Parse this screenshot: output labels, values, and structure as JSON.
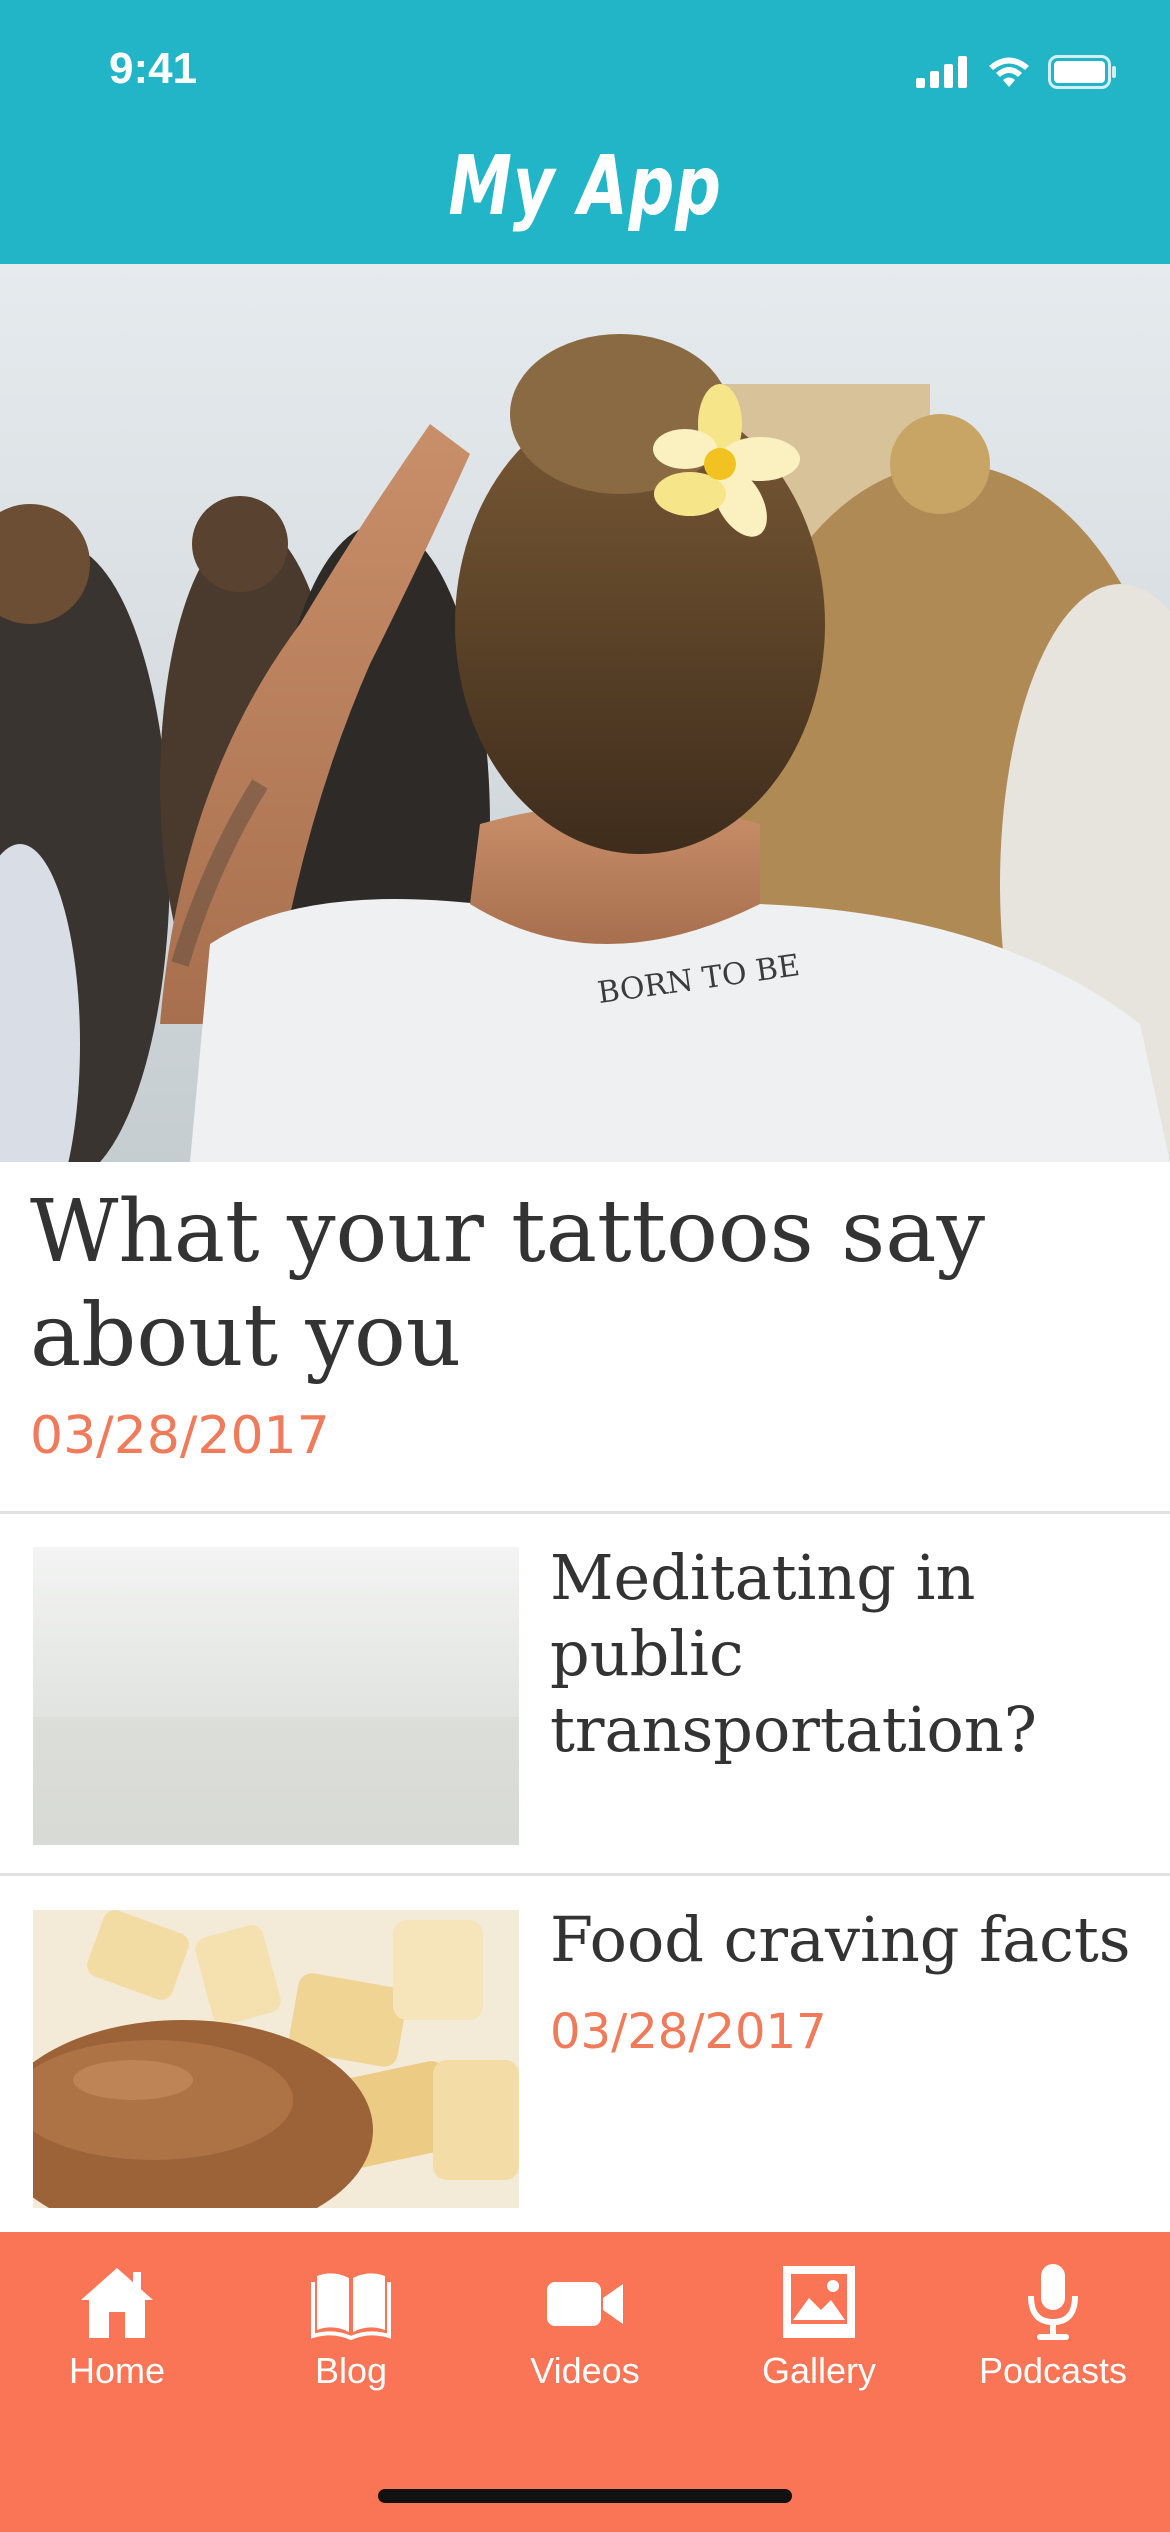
{
  "status_bar": {
    "time": "9:41"
  },
  "header": {
    "title": "My App",
    "color": "#22b5c8"
  },
  "featured": {
    "title": "What your tattoos say about you",
    "date": "03/28/2017"
  },
  "articles": [
    {
      "title": "Meditating in public transportation?"
    },
    {
      "title": "Food craving facts",
      "date": "03/28/2017"
    }
  ],
  "tabbar": {
    "color": "#fa7456",
    "tabs": [
      {
        "label": "Home",
        "icon": "home-icon"
      },
      {
        "label": "Blog",
        "icon": "book-icon"
      },
      {
        "label": "Videos",
        "icon": "video-camera-icon"
      },
      {
        "label": "Gallery",
        "icon": "image-icon"
      },
      {
        "label": "Podcasts",
        "icon": "microphone-icon"
      }
    ]
  },
  "accent_color": "#f07b5a"
}
